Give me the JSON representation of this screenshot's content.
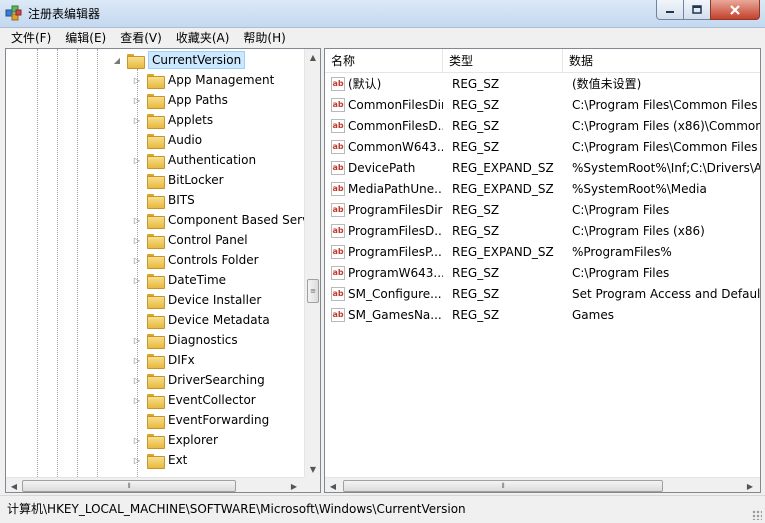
{
  "window": {
    "title": "注册表编辑器",
    "app_icon": "regedit-icon"
  },
  "menu": [
    "文件(F)",
    "编辑(E)",
    "查看(V)",
    "收藏夹(A)",
    "帮助(H)"
  ],
  "tree": {
    "selected": "CurrentVersion",
    "children": [
      {
        "label": "App Management",
        "expandable": true
      },
      {
        "label": "App Paths",
        "expandable": true
      },
      {
        "label": "Applets",
        "expandable": true
      },
      {
        "label": "Audio",
        "expandable": false
      },
      {
        "label": "Authentication",
        "expandable": true
      },
      {
        "label": "BitLocker",
        "expandable": false
      },
      {
        "label": "BITS",
        "expandable": false
      },
      {
        "label": "Component Based Serv",
        "expandable": true
      },
      {
        "label": "Control Panel",
        "expandable": true
      },
      {
        "label": "Controls Folder",
        "expandable": true
      },
      {
        "label": "DateTime",
        "expandable": true
      },
      {
        "label": "Device Installer",
        "expandable": false
      },
      {
        "label": "Device Metadata",
        "expandable": false
      },
      {
        "label": "Diagnostics",
        "expandable": true
      },
      {
        "label": "DIFx",
        "expandable": true
      },
      {
        "label": "DriverSearching",
        "expandable": true
      },
      {
        "label": "EventCollector",
        "expandable": true
      },
      {
        "label": "EventForwarding",
        "expandable": false
      },
      {
        "label": "Explorer",
        "expandable": true
      },
      {
        "label": "Ext",
        "expandable": true
      }
    ]
  },
  "list": {
    "columns": [
      "名称",
      "类型",
      "数据"
    ],
    "rows": [
      {
        "name": "(默认)",
        "type": "REG_SZ",
        "data": "(数值未设置)"
      },
      {
        "name": "CommonFilesDir",
        "type": "REG_SZ",
        "data": "C:\\Program Files\\Common Files"
      },
      {
        "name": "CommonFilesD...",
        "type": "REG_SZ",
        "data": "C:\\Program Files (x86)\\Common"
      },
      {
        "name": "CommonW643...",
        "type": "REG_SZ",
        "data": "C:\\Program Files\\Common Files"
      },
      {
        "name": "DevicePath",
        "type": "REG_EXPAND_SZ",
        "data": "%SystemRoot%\\Inf;C:\\Drivers\\A"
      },
      {
        "name": "MediaPathUne...",
        "type": "REG_EXPAND_SZ",
        "data": "%SystemRoot%\\Media"
      },
      {
        "name": "ProgramFilesDir",
        "type": "REG_SZ",
        "data": "C:\\Program Files"
      },
      {
        "name": "ProgramFilesD...",
        "type": "REG_SZ",
        "data": "C:\\Program Files (x86)"
      },
      {
        "name": "ProgramFilesP...",
        "type": "REG_EXPAND_SZ",
        "data": "%ProgramFiles%"
      },
      {
        "name": "ProgramW643...",
        "type": "REG_SZ",
        "data": "C:\\Program Files"
      },
      {
        "name": "SM_Configure...",
        "type": "REG_SZ",
        "data": "Set Program Access and Defaul"
      },
      {
        "name": "SM_GamesNa...",
        "type": "REG_SZ",
        "data": "Games"
      }
    ]
  },
  "status": {
    "path": "计算机\\HKEY_LOCAL_MACHINE\\SOFTWARE\\Microsoft\\Windows\\CurrentVersion"
  }
}
